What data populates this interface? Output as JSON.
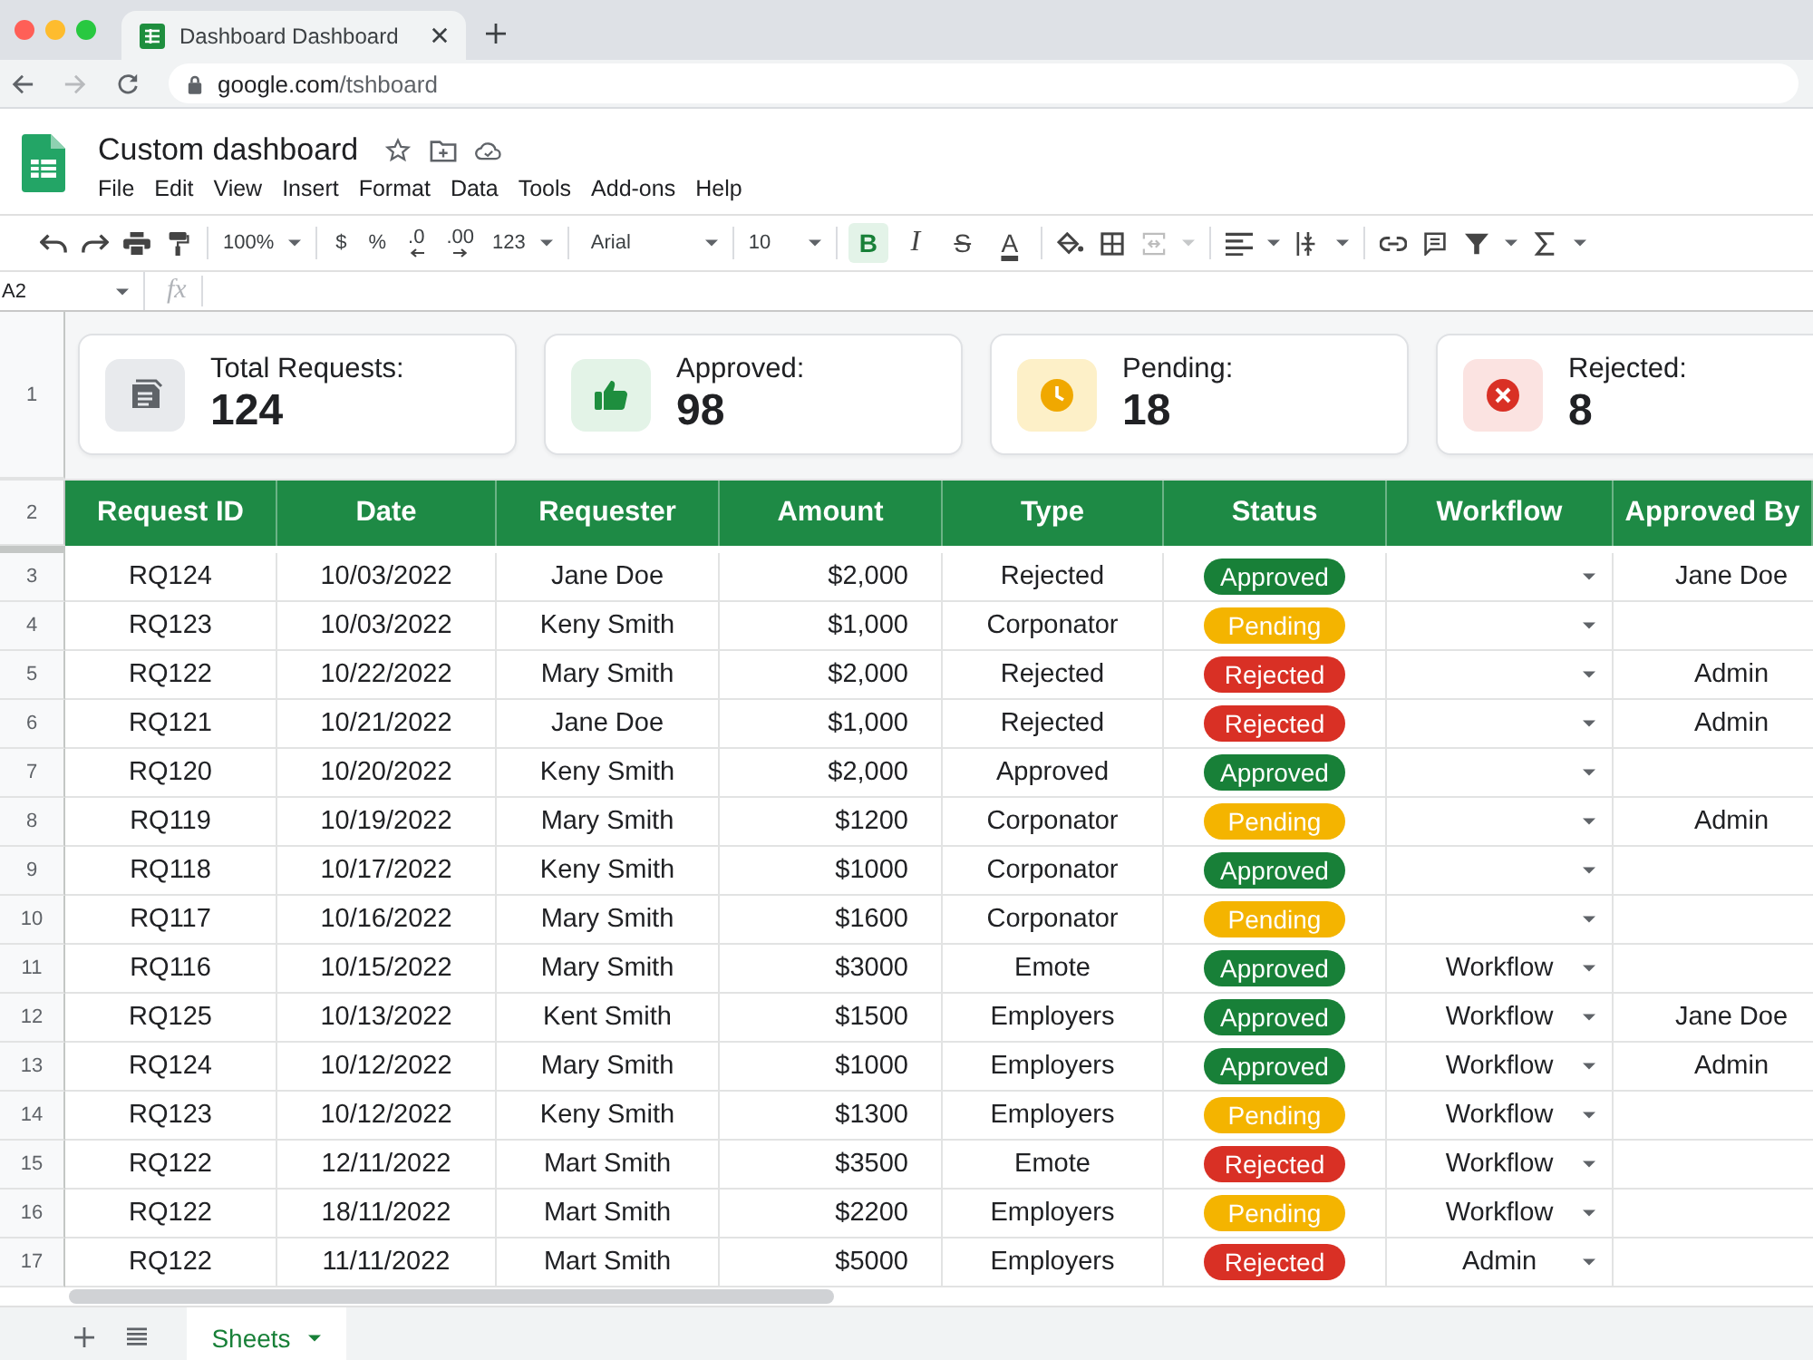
{
  "browser": {
    "tab_title": "Dashboard Dashboard",
    "url_host": "google.com",
    "url_path": "/tshboard",
    "forward_disabled": true
  },
  "document": {
    "title": "Custom dashboard",
    "menu": [
      "File",
      "Edit",
      "View",
      "Insert",
      "Format",
      "Data",
      "Tools",
      "Add-ons",
      "Help"
    ]
  },
  "toolbar": {
    "zoom": "100%",
    "currency": "$",
    "percent": "%",
    "decimal_decrease": ".0",
    "decimal_increase": ".00",
    "number_format": "123",
    "font": "Arial",
    "font_size": "10",
    "text_styles": [
      {
        "kind": "bold",
        "label": "B",
        "selected": true
      },
      {
        "kind": "italic",
        "label": "I",
        "selected": false
      },
      {
        "kind": "strikethrough",
        "label": "S",
        "selected": false
      },
      {
        "kind": "text_color",
        "label": "A",
        "selected": false
      }
    ],
    "merge_disabled": true
  },
  "formula_bar": {
    "cell": "A2",
    "function_label": "fx"
  },
  "sheet": {
    "summary_row": "1",
    "cards": [
      {
        "kind": "total",
        "label": "Total Requests:",
        "value": "124"
      },
      {
        "kind": "approved",
        "label": "Approved:",
        "value": "98"
      },
      {
        "kind": "pending",
        "label": "Pending:",
        "value": "18"
      },
      {
        "kind": "rejected",
        "label": "Rejected:",
        "value": "8"
      }
    ],
    "header_row": "2",
    "columns": [
      "Request ID",
      "Date",
      "Requester",
      "Amount",
      "Type",
      "Status",
      "Workflow",
      "Approved By"
    ],
    "rows": [
      {
        "n": "3",
        "id": "RQ124",
        "date": "10/03/2022",
        "requester": "Jane Doe",
        "amount": "$2,000",
        "type": "Rejected",
        "status": "Approved",
        "color": "#188038",
        "approved_by": "Jane Doe"
      },
      {
        "n": "4",
        "id": "RQ123",
        "date": "10/03/2022",
        "requester": "Keny Smith",
        "amount": "$1,000",
        "type": "Corponator",
        "status": "Pending",
        "color": "#f4b400"
      },
      {
        "n": "5",
        "id": "RQ122",
        "date": "10/22/2022",
        "requester": "Mary Smith",
        "amount": "$2,000",
        "type": "Rejected",
        "status": "Rejected",
        "color": "#d93025",
        "approved_by": "Admin"
      },
      {
        "n": "6",
        "id": "RQ121",
        "date": "10/21/2022",
        "requester": "Jane Doe",
        "amount": "$1,000",
        "type": "Rejected",
        "status": "Rejected",
        "color": "#d93025",
        "approved_by": "Admin"
      },
      {
        "n": "7",
        "id": "RQ120",
        "date": "10/20/2022",
        "requester": "Keny Smith",
        "amount": "$2,000",
        "type": "Approved",
        "status": "Approved",
        "color": "#188038"
      },
      {
        "n": "8",
        "id": "RQ119",
        "date": "10/19/2022",
        "requester": "Mary Smith",
        "amount": "$1200",
        "type": "Corponator",
        "status": "Pending",
        "color": "#f4b400",
        "approved_by": "Admin"
      },
      {
        "n": "9",
        "id": "RQ118",
        "date": "10/17/2022",
        "requester": "Keny Smith",
        "amount": "$1000",
        "type": "Corponator",
        "status": "Approved",
        "color": "#188038"
      },
      {
        "n": "10",
        "id": "RQ117",
        "date": "10/16/2022",
        "requester": "Mary Smith",
        "amount": "$1600",
        "type": "Corponator",
        "status": "Pending",
        "color": "#f4b400"
      },
      {
        "n": "11",
        "id": "RQ116",
        "date": "10/15/2022",
        "requester": "Mary Smith",
        "amount": "$3000",
        "type": "Emote",
        "status": "Approved",
        "color": "#188038",
        "workflow": "Workflow"
      },
      {
        "n": "12",
        "id": "RQ125",
        "date": "10/13/2022",
        "requester": "Kent Smith",
        "amount": "$1500",
        "type": "Employers",
        "status": "Approved",
        "color": "#188038",
        "workflow": "Workflow",
        "approved_by": "Jane Doe"
      },
      {
        "n": "13",
        "id": "RQ124",
        "date": "10/12/2022",
        "requester": "Mary Smith",
        "amount": "$1000",
        "type": "Employers",
        "status": "Approved",
        "color": "#188038",
        "workflow": "Workflow",
        "approved_by": "Admin"
      },
      {
        "n": "14",
        "id": "RQ123",
        "date": "10/12/2022",
        "requester": "Keny Smith",
        "amount": "$1300",
        "type": "Employers",
        "status": "Pending",
        "color": "#f4b400",
        "workflow": "Workflow"
      },
      {
        "n": "15",
        "id": "RQ122",
        "date": "12/11/2022",
        "requester": "Mart Smith",
        "amount": "$3500",
        "type": "Emote",
        "status": "Rejected",
        "color": "#d93025",
        "workflow": "Workflow"
      },
      {
        "n": "16",
        "id": "RQ122",
        "date": "18/11/2022",
        "requester": "Mart Smith",
        "amount": "$2200",
        "type": "Employers",
        "status": "Pending",
        "color": "#f4b400",
        "workflow": "Workflow"
      },
      {
        "n": "17",
        "id": "RQ122",
        "date": "11/11/2022",
        "requester": "Mart Smith",
        "amount": "$5000",
        "type": "Employers",
        "status": "Rejected",
        "color": "#d93025",
        "workflow": "Admin"
      }
    ]
  },
  "sheet_tabs": [
    {
      "label": "Sheets",
      "selected": true
    }
  ]
}
